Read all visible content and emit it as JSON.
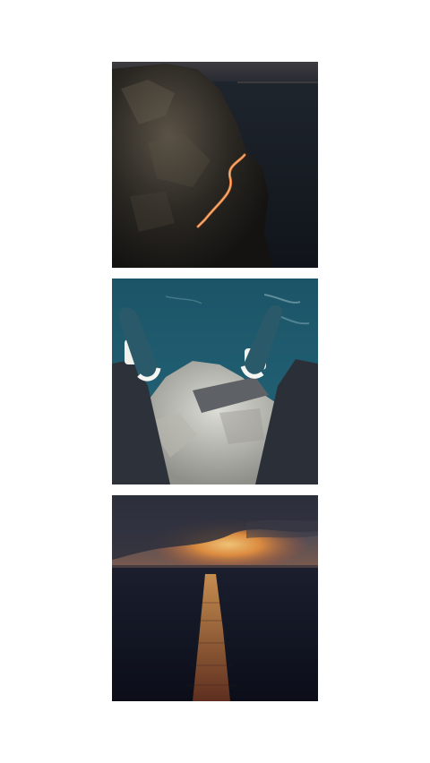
{
  "gallery": {
    "background": "#ffffff",
    "photos": [
      {
        "subject": "coastal-cliff-night-road",
        "palette": [
          "#1b1a17",
          "#262b33",
          "#e2763a"
        ]
      },
      {
        "subject": "feet-over-cliff-above-sea",
        "palette": [
          "#1f5a6e",
          "#2c313a",
          "#cfcfcb"
        ]
      },
      {
        "subject": "sunset-over-sea",
        "palette": [
          "#3a3d4c",
          "#e08a3c",
          "#0f1322"
        ]
      }
    ]
  }
}
